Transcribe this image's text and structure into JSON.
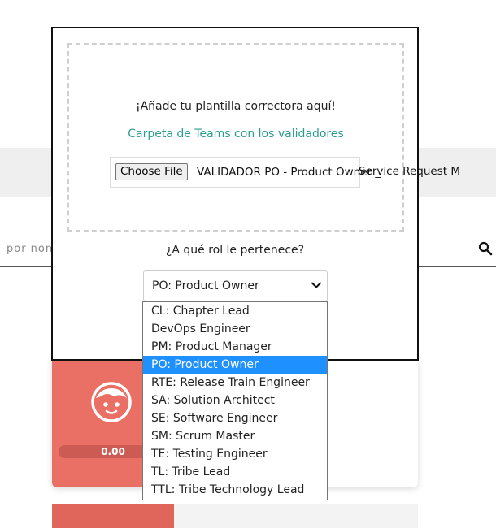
{
  "background": {
    "search_placeholder": "por nom",
    "card_progress": "0.00"
  },
  "modal": {
    "dropzone_title": "¡Añade tu plantilla correctora aquí!",
    "teams_link": "Carpeta de Teams con los validadores",
    "choose_file_label": "Choose File",
    "file_name_visible": "VALIDADOR PO - Product Owner _",
    "file_name_overflow": "Service Request M",
    "role_question": "¿A qué rol le pertenece?",
    "role_selected": "PO: Product Owner"
  },
  "role_options": [
    {
      "label": "CL: Chapter Lead",
      "selected": false
    },
    {
      "label": "DevOps Engineer",
      "selected": false
    },
    {
      "label": "PM: Product Manager",
      "selected": false
    },
    {
      "label": "PO: Product Owner",
      "selected": true
    },
    {
      "label": "RTE: Release Train Engineer",
      "selected": false
    },
    {
      "label": "SA: Solution Architect",
      "selected": false
    },
    {
      "label": "SE: Software Engineer",
      "selected": false
    },
    {
      "label": "SM: Scrum Master",
      "selected": false
    },
    {
      "label": "TE: Testing Engineer",
      "selected": false
    },
    {
      "label": "TL: Tribe Lead",
      "selected": false
    },
    {
      "label": "TTL: Tribe Technology Lead",
      "selected": false
    }
  ],
  "colors": {
    "link": "#2a9d8f",
    "card_accent": "#ea7065",
    "selected_option": "#1e90ff"
  },
  "icons": [
    "search-icon",
    "avatar-face-icon",
    "chevron-down-icon"
  ]
}
